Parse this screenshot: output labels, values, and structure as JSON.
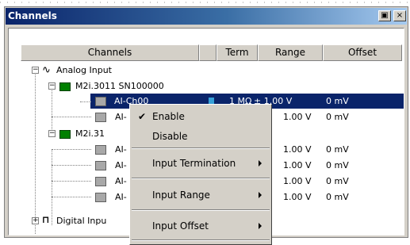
{
  "window": {
    "title": "Channels"
  },
  "columns": [
    "Channels",
    "Term",
    "Range",
    "Offset"
  ],
  "tree": {
    "analog_input": "Analog Input",
    "device1": "M2i.3011 SN100000",
    "device2": "M2i.31",
    "digital_input": "Digital Inpu",
    "channels": [
      {
        "name": "AI-Ch00",
        "term": "1 MΩ",
        "range": "± 1.00 V",
        "offset": "0 mV"
      },
      {
        "name": "AI-",
        "range": "1.00 V",
        "offset": "0 mV"
      },
      {
        "name": "AI-",
        "range": "1.00 V",
        "offset": "0 mV"
      },
      {
        "name": "AI-",
        "range": "1.00 V",
        "offset": "0 mV"
      },
      {
        "name": "AI-",
        "range": "1.00 V",
        "offset": "0 mV"
      },
      {
        "name": "AI-",
        "range": "1.00 V",
        "offset": "0 mV"
      }
    ]
  },
  "context_menu": {
    "enable": "Enable",
    "disable": "Disable",
    "input_termination": "Input Termination",
    "input_range": "Input Range",
    "input_offset": "Input Offset"
  },
  "icons": {
    "pin": "pin-icon",
    "close": "close-icon"
  },
  "colors": {
    "selection": "#0a246a",
    "title_start": "#0a246a",
    "title_end": "#a6caf0"
  }
}
